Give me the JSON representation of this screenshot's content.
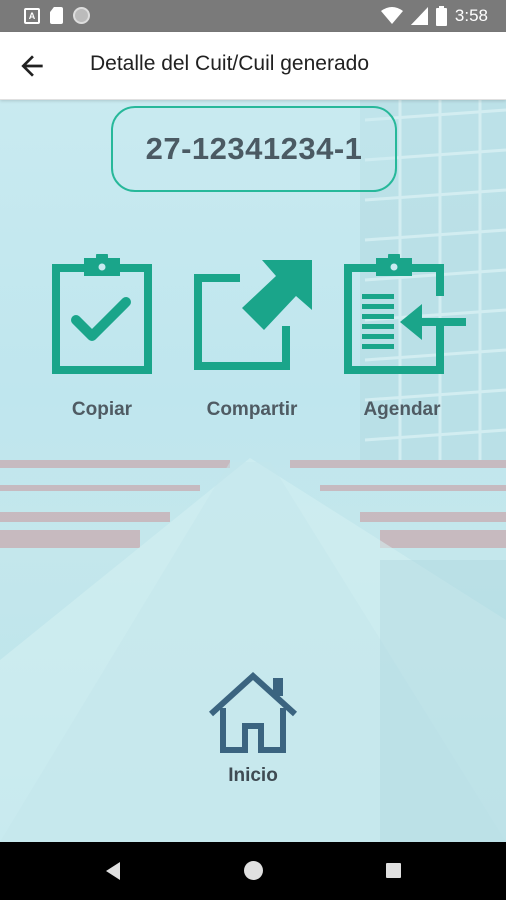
{
  "status_bar": {
    "time": "3:58",
    "icons": [
      "text-notification-icon",
      "sd-card-icon",
      "circle-notification-icon",
      "wifi-icon",
      "signal-icon",
      "battery-icon"
    ]
  },
  "app_bar": {
    "title": "Detalle del Cuit/Cuil generado",
    "back_icon": "arrow-back-icon"
  },
  "cuit": {
    "value": "27-12341234-1"
  },
  "actions": [
    {
      "label": "Copiar",
      "icon": "clipboard-check-icon"
    },
    {
      "label": "Compartir",
      "icon": "share-external-icon"
    },
    {
      "label": "Agendar",
      "icon": "clipboard-import-icon"
    }
  ],
  "home": {
    "label": "Inicio",
    "icon": "home-icon"
  },
  "colors": {
    "accent": "#1aa58a",
    "border": "#27b89a",
    "text_dark": "#4b5a63",
    "home_icon": "#3b6480"
  },
  "nav_bar": {
    "buttons": [
      "back-nav-icon",
      "home-nav-icon",
      "recents-nav-icon"
    ]
  }
}
